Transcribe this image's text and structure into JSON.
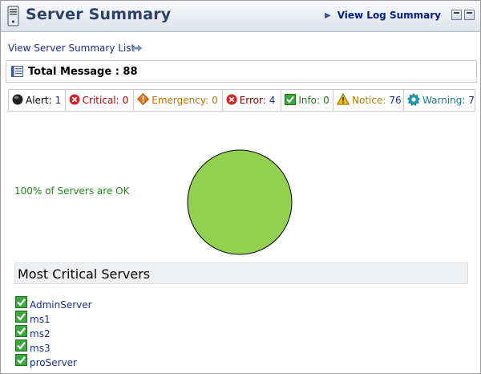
{
  "header": {
    "title": "Server Summary",
    "log_link": "View Log Summary"
  },
  "summary_list_link": "View Server Summary List",
  "total": {
    "label": "Total Message : 88"
  },
  "counts": [
    {
      "label": "Alert:",
      "value": "1",
      "icon": "alert-icon",
      "color": "#000000"
    },
    {
      "label": "Critical:",
      "value": "0",
      "icon": "critical-icon",
      "color": "#b00000"
    },
    {
      "label": "Emergency:",
      "value": "0",
      "icon": "emergency-icon",
      "color": "#c36a00"
    },
    {
      "label": "Error:",
      "value": "4",
      "icon": "error-icon",
      "color": "#8a0000"
    },
    {
      "label": "Info:",
      "value": "0",
      "icon": "info-icon",
      "color": "#1c7a1c"
    },
    {
      "label": "Notice:",
      "value": "76",
      "icon": "notice-icon",
      "color": "#b08000"
    },
    {
      "label": "Warning:",
      "value": "7",
      "icon": "warning-icon",
      "color": "#1a7a8a"
    }
  ],
  "chart_data": {
    "type": "pie",
    "categories": [
      "OK"
    ],
    "values": [
      100
    ],
    "colors": [
      "#92d050"
    ],
    "annotation": "100% of Servers are OK"
  },
  "most_critical": {
    "title": "Most Critical Servers",
    "servers": [
      "AdminServer",
      "ms1",
      "ms2",
      "ms3",
      "proServer"
    ]
  },
  "colors": {
    "title": "#2b4168",
    "link": "#1a2d8a",
    "ok_green": "#1c8a1c",
    "pie_fill": "#92d050"
  }
}
